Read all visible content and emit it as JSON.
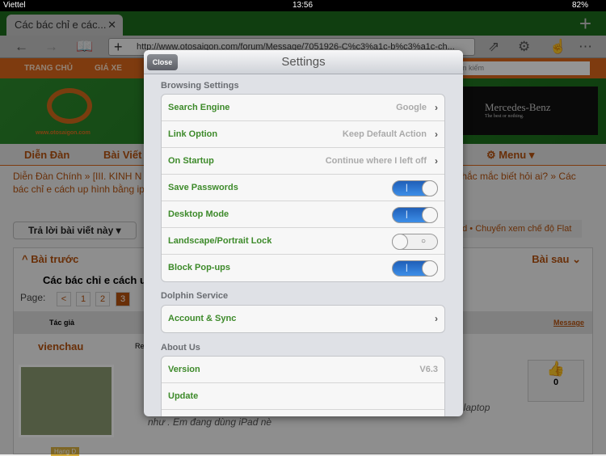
{
  "status": {
    "carrier": "Viettel",
    "time": "13:56",
    "battery": "82%"
  },
  "browser": {
    "tab_title": "Các bác chỉ e các...",
    "url": "http://www.otosaigon.com/forum/Message/7051926-C%c3%a1c-b%c3%a1c-ch..."
  },
  "site": {
    "top_nav": [
      "TRANG CHỦ",
      "GIÁ XE"
    ],
    "search_placeholder": "Tìm kiếm",
    "logo_url_text": "www.otosaigon.com",
    "ad_brand": "Mercedes-Benz",
    "ad_tagline": "The best or nothing.",
    "main_nav": {
      "forum": "Diễn Đàn",
      "posts": "Bài Viết",
      "menu": "Menu"
    },
    "breadcrumb_line1": "Diễn Đàn Chính  »  [III. KINH N",
    "breadcrumb_line1_right": "thắc mắc biết hỏi ai?  »  Các",
    "breadcrumb_line2": "bác chỉ e cách up hình bằng ipad",
    "reply_button": "Trả lời bài viết này",
    "thread_options": "ad  •  Chuyển xem chế độ Flat",
    "prev": "Bài trước",
    "next": "Bài sau",
    "thread_title": "Các bác chỉ e cách up",
    "page_label": "Page:",
    "pages": [
      "<",
      "1",
      "2",
      "3"
    ],
    "author_header": "Tác giả",
    "message_header": "Message",
    "author": "vienchau",
    "re": "Re:",
    "post_text_right": "ên laptop",
    "post_text": "như          . Em đang dùng iPad nè",
    "likes": "0",
    "badge": "Hạng D"
  },
  "settings": {
    "title": "Settings",
    "close": "Close",
    "sections": [
      {
        "title": "Browsing Settings",
        "rows": [
          {
            "label": "Search Engine",
            "value": "Google",
            "type": "link"
          },
          {
            "label": "Link Option",
            "value": "Keep Default Action",
            "type": "link"
          },
          {
            "label": "On Startup",
            "value": "Continue where I left off",
            "type": "link"
          },
          {
            "label": "Save Passwords",
            "type": "toggle",
            "on": true
          },
          {
            "label": "Desktop Mode",
            "type": "toggle",
            "on": true
          },
          {
            "label": "Landscape/Portrait Lock",
            "type": "toggle",
            "on": false
          },
          {
            "label": "Block Pop-ups",
            "type": "toggle",
            "on": true
          }
        ]
      },
      {
        "title": "Dolphin Service",
        "rows": [
          {
            "label": "Account & Sync",
            "type": "link"
          }
        ]
      },
      {
        "title": "About Us",
        "rows": [
          {
            "label": "Version",
            "value": "V6.3",
            "type": "value"
          },
          {
            "label": "Update",
            "type": "plain"
          }
        ]
      }
    ]
  },
  "colors": {
    "accent_green": "#3d8a2a",
    "toggle_blue": "#2a75d4",
    "site_orange": "#d9661a"
  }
}
